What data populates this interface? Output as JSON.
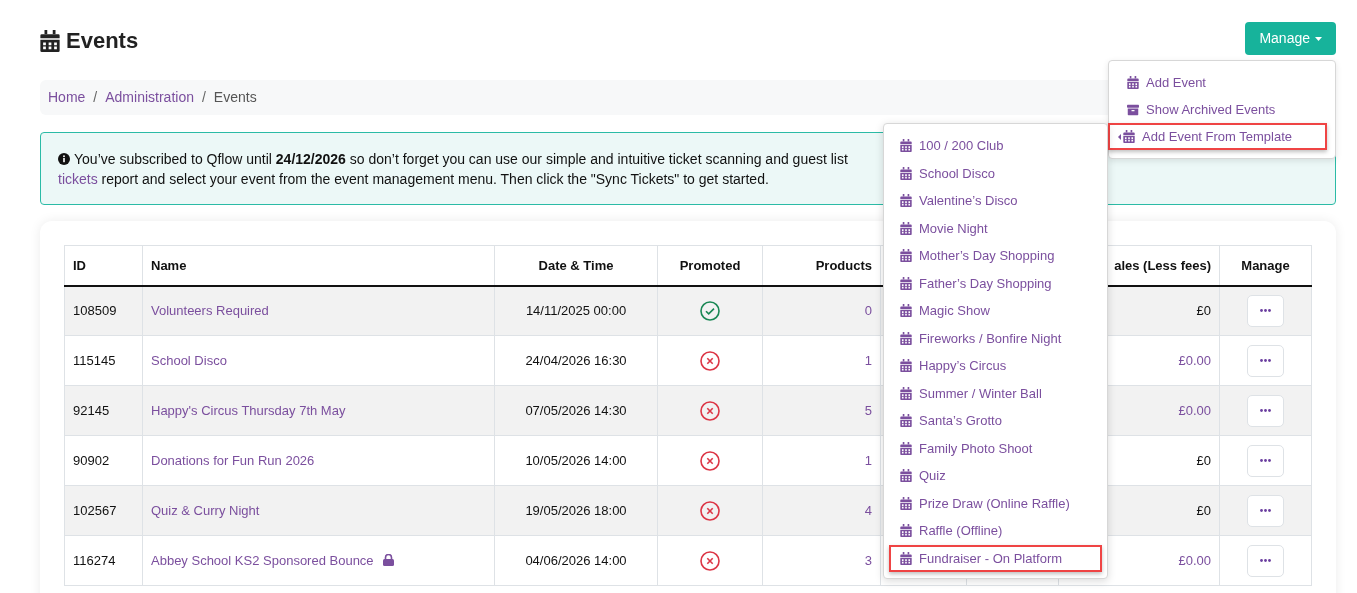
{
  "page_title": "Events",
  "manage_button": "Manage",
  "breadcrumb": [
    {
      "label": "Home",
      "link": true
    },
    {
      "separator": "/"
    },
    {
      "label": "Administration",
      "link": true
    },
    {
      "separator": "/"
    },
    {
      "label": "Events",
      "link": false
    }
  ],
  "alert": {
    "before": "You’ve subscribed to Qflow until **24/12/2026** so don’t forget you can use our simple and intuitive ticket scanning and guest list",
    "link": "tickets",
    "after": "report and select your event from the event management menu. Then click the \"Sync Tickets\" to get started."
  },
  "table": {
    "columns": [
      "ID",
      "Name",
      "Date & Time",
      "Promoted",
      "Products",
      "ales (Less fees)",
      "Manage"
    ],
    "rows": [
      {
        "id": "108509",
        "name": "Volunteers Required",
        "locked": false,
        "date": "14/11/2025 00:00",
        "promoted": true,
        "products": "0",
        "sales": "£0",
        "sales_link": false
      },
      {
        "id": "115145",
        "name": "School Disco",
        "locked": false,
        "date": "24/04/2026 16:30",
        "promoted": false,
        "products": "1",
        "sales": "£0.00",
        "sales_link": true
      },
      {
        "id": "92145",
        "name": "Happy's Circus Thursday 7th May",
        "locked": false,
        "date": "07/05/2026 14:30",
        "promoted": false,
        "products": "5",
        "sales": "£0.00",
        "sales_link": true
      },
      {
        "id": "90902",
        "name": "Donations for Fun Run 2026",
        "locked": false,
        "date": "10/05/2026 14:00",
        "promoted": false,
        "products": "1",
        "sales": "£0",
        "sales_link": false
      },
      {
        "id": "102567",
        "name": "Quiz & Curry Night",
        "locked": false,
        "date": "19/05/2026 18:00",
        "promoted": false,
        "products": "4",
        "sales": "£0",
        "sales_link": false
      },
      {
        "id": "116274",
        "name": "Abbey School KS2 Sponsored Bounce",
        "locked": true,
        "date": "04/06/2026 14:00",
        "promoted": false,
        "products": "3",
        "sales": "£0.00",
        "sales_link": true
      }
    ]
  },
  "manage_menu": [
    {
      "label": "Add Event",
      "kind": "calendar",
      "highlighted": false,
      "submenu": false
    },
    {
      "label": "Show Archived Events",
      "kind": "archive",
      "highlighted": false,
      "submenu": false
    },
    {
      "label": "Add Event From Template",
      "kind": "calendar",
      "highlighted": true,
      "submenu": true
    }
  ],
  "template_menu": [
    {
      "label": "100 / 200 Club",
      "highlighted": false
    },
    {
      "label": "School Disco",
      "highlighted": false
    },
    {
      "label": "Valentine’s Disco",
      "highlighted": false
    },
    {
      "label": "Movie Night",
      "highlighted": false
    },
    {
      "label": "Mother’s Day Shopping",
      "highlighted": false
    },
    {
      "label": "Father’s Day Shopping",
      "highlighted": false
    },
    {
      "label": "Magic Show",
      "highlighted": false
    },
    {
      "label": "Fireworks / Bonfire Night",
      "highlighted": false
    },
    {
      "label": "Happy’s Circus",
      "highlighted": false
    },
    {
      "label": "Summer / Winter Ball",
      "highlighted": false
    },
    {
      "label": "Santa’s Grotto",
      "highlighted": false
    },
    {
      "label": "Family Photo Shoot",
      "highlighted": false
    },
    {
      "label": "Quiz",
      "highlighted": false
    },
    {
      "label": "Prize Draw (Online Raffle)",
      "highlighted": false
    },
    {
      "label": "Raffle (Offline)",
      "highlighted": false
    },
    {
      "label": "Fundraiser - On Platform",
      "highlighted": true
    }
  ]
}
